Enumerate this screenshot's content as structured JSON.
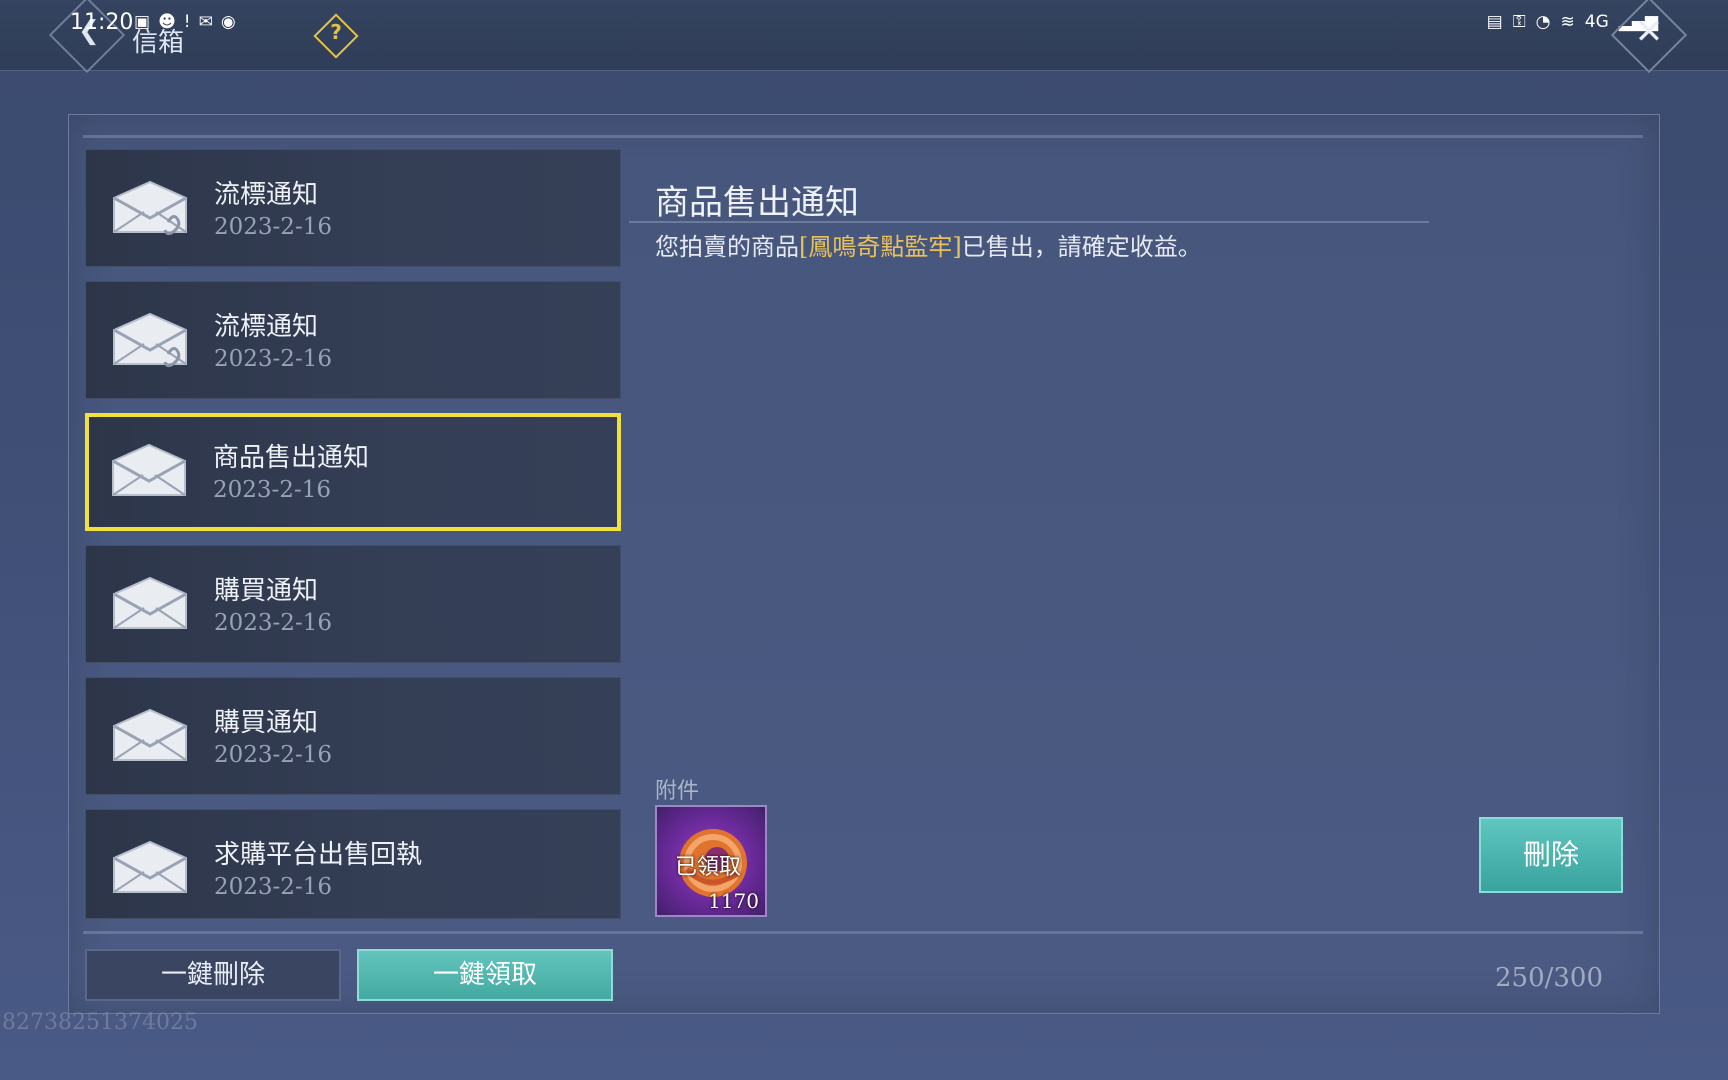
{
  "status_bar": {
    "time": "11:20",
    "left_icons": [
      "tv-icon",
      "qq-icon",
      "alert-icon",
      "wechat-icon",
      "tips-icon"
    ],
    "right_icons": [
      "hd-icon",
      "key-icon",
      "speed-icon",
      "wifi-icon",
      "signal-icon",
      "battery-icon"
    ],
    "network_label": "4G"
  },
  "header": {
    "title": "信箱",
    "help_icon": "question-icon",
    "close_icon": "close-icon"
  },
  "mails": [
    {
      "title": "流標通知",
      "date": "2023-2-16",
      "has_attachment": true,
      "selected": false
    },
    {
      "title": "流標通知",
      "date": "2023-2-16",
      "has_attachment": true,
      "selected": false
    },
    {
      "title": "商品售出通知",
      "date": "2023-2-16",
      "has_attachment": false,
      "selected": true
    },
    {
      "title": "購買通知",
      "date": "2023-2-16",
      "has_attachment": false,
      "selected": false
    },
    {
      "title": "購買通知",
      "date": "2023-2-16",
      "has_attachment": false,
      "selected": false
    },
    {
      "title": "求購平台出售回執",
      "date": "2023-2-16",
      "has_attachment": false,
      "selected": false
    }
  ],
  "detail": {
    "title": "商品售出通知",
    "body_prefix": "您拍賣的商品",
    "body_item": "[鳳鳴奇點監牢]",
    "body_suffix": "已售出，請確定收益。",
    "attachment_label": "附件",
    "attachment": {
      "status": "已領取",
      "quantity": "1170",
      "icon": "coin-icon"
    },
    "delete_label": "刪除"
  },
  "footer": {
    "bulk_delete_label": "一鍵刪除",
    "bulk_claim_label": "一鍵領取",
    "mail_count": "250/300"
  },
  "user_id": "82738251374025",
  "colors": {
    "selected_border": "#f2e13a",
    "item_highlight": "#e8c15a",
    "accent_teal": "#4fb7b0"
  }
}
